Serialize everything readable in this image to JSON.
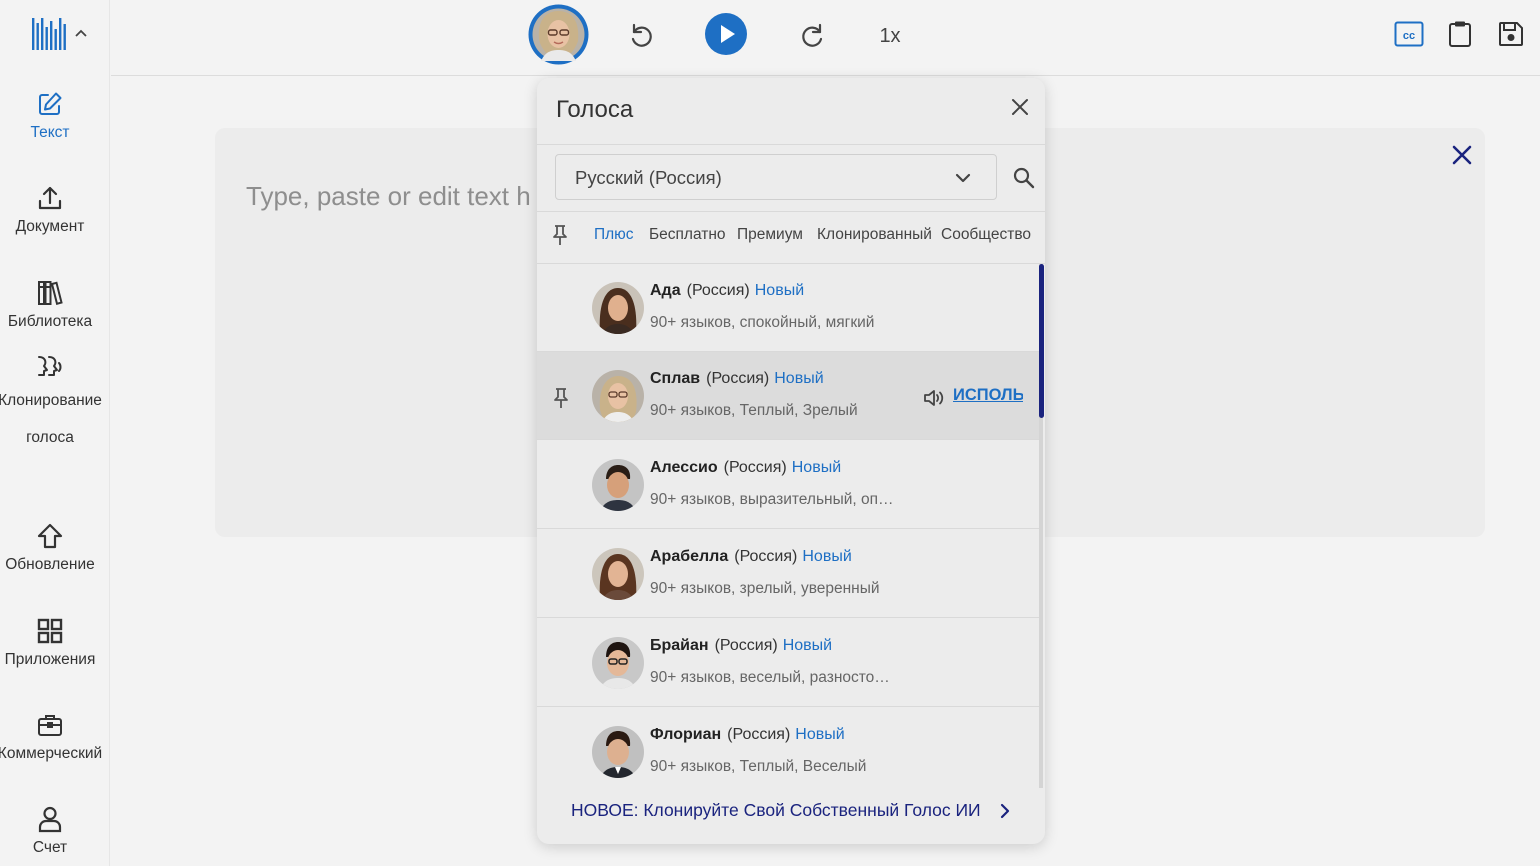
{
  "sidebar": {
    "items": [
      {
        "label": "Текст",
        "icon": "edit-icon"
      },
      {
        "label": "Документ",
        "icon": "upload-icon"
      },
      {
        "label": "Библиотека",
        "icon": "library-icon"
      },
      {
        "label": "Клонирование голоса",
        "icon": "voice-clone-icon"
      },
      {
        "label": "Обновление",
        "icon": "upgrade-icon"
      },
      {
        "label": "Приложения",
        "icon": "apps-grid-icon"
      },
      {
        "label": "Коммерческий",
        "icon": "briefcase-icon"
      },
      {
        "label": "Счет",
        "icon": "account-icon"
      }
    ]
  },
  "toolbar": {
    "speed": "1x",
    "cc": "CC"
  },
  "editor": {
    "placeholder": "Type, paste or edit text h"
  },
  "voice_panel": {
    "title": "Голоса",
    "language": "Русский (Россия)",
    "tabs": [
      "Плюс",
      "Бесплатно",
      "Премиум",
      "Клонированный",
      "Сообщество"
    ],
    "active_tab": "Плюс",
    "use_label": "ИСПОЛЬЗ",
    "voices": [
      {
        "name": "Ада",
        "region": "(Россия)",
        "badge": "Новый",
        "desc": "90+ языков, спокойный, мягкий"
      },
      {
        "name": "Сплав",
        "region": "(Россия)",
        "badge": "Новый",
        "desc": "90+ языков, Теплый, Зрелый"
      },
      {
        "name": "Алессио",
        "region": "(Россия)",
        "badge": "Новый",
        "desc": "90+ языков, выразительный, оп…"
      },
      {
        "name": "Арабелла",
        "region": "(Россия)",
        "badge": "Новый",
        "desc": "90+ языков, зрелый, уверенный"
      },
      {
        "name": "Брайан",
        "region": "(Россия)",
        "badge": "Новый",
        "desc": "90+ языков, веселый, разносто…"
      },
      {
        "name": "Флориан",
        "region": "(Россия)",
        "badge": "Новый",
        "desc": "90+ языков, Теплый, Веселый"
      }
    ],
    "promo": "НОВОЕ: Клонируйте Свой Собственный Голос ИИ"
  },
  "colors": {
    "accent": "#1e6fc4",
    "navy": "#1a237e",
    "background": "#f3f3f3"
  }
}
